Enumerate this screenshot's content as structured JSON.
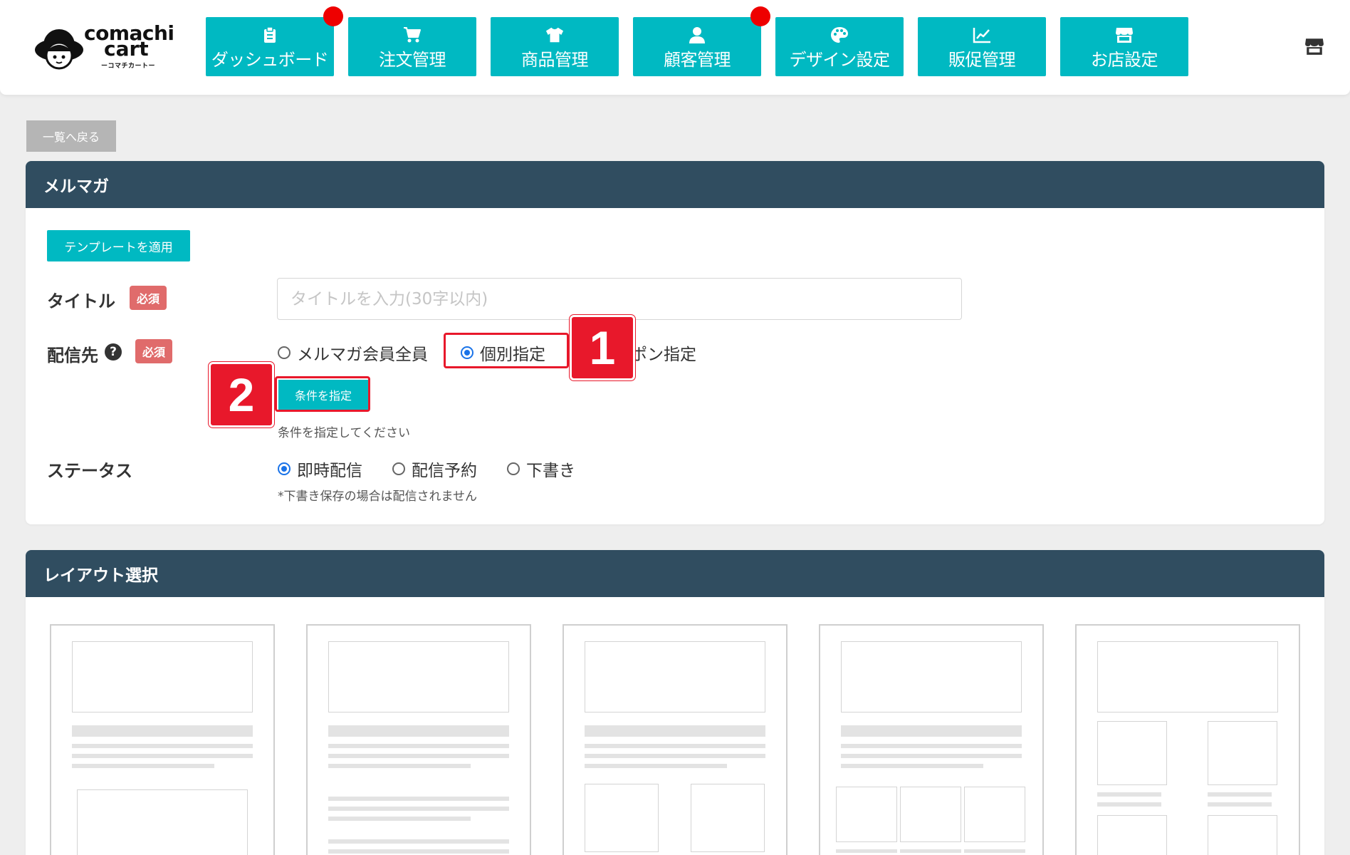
{
  "header": {
    "logo": {
      "line1": "comachi",
      "line2": "cart",
      "sub": "ーコマチカートー"
    },
    "nav": [
      {
        "label": "ダッシュボード",
        "icon": "clipboard-icon",
        "notify": true
      },
      {
        "label": "注文管理",
        "icon": "cart-icon",
        "notify": false
      },
      {
        "label": "商品管理",
        "icon": "tshirt-icon",
        "notify": false
      },
      {
        "label": "顧客管理",
        "icon": "user-icon",
        "notify": true
      },
      {
        "label": "デザイン設定",
        "icon": "palette-icon",
        "notify": false
      },
      {
        "label": "販促管理",
        "icon": "chart-line-icon",
        "notify": false
      },
      {
        "label": "お店設定",
        "icon": "store-icon",
        "notify": false
      }
    ],
    "right_icon": "store-icon"
  },
  "back_label": "一覧へ戻る",
  "mailmag": {
    "heading": "メルマガ",
    "template_button": "テンプレートを適用",
    "title_label": "タイトル",
    "required": "必須",
    "title_placeholder": "タイトルを入力(30字以内)",
    "dest_label": "配信先",
    "dest_options": [
      "メルマガ会員全員",
      "個別指定",
      "ポン指定"
    ],
    "dest_selected": "個別指定",
    "condition_button": "条件を指定",
    "condition_hint": "条件を指定してください",
    "status_label": "ステータス",
    "status_options": [
      "即時配信",
      "配信予約",
      "下書き"
    ],
    "status_selected": "即時配信",
    "status_note": "*下書き保存の場合は配信されません"
  },
  "annotations": [
    "1",
    "2"
  ],
  "layout": {
    "heading": "レイアウト選択"
  },
  "colors": {
    "accent": "#00b9c2",
    "panel_header": "#304d60",
    "required": "#e06b6b",
    "highlight": "#e8182b",
    "notify": "#ee0000"
  }
}
